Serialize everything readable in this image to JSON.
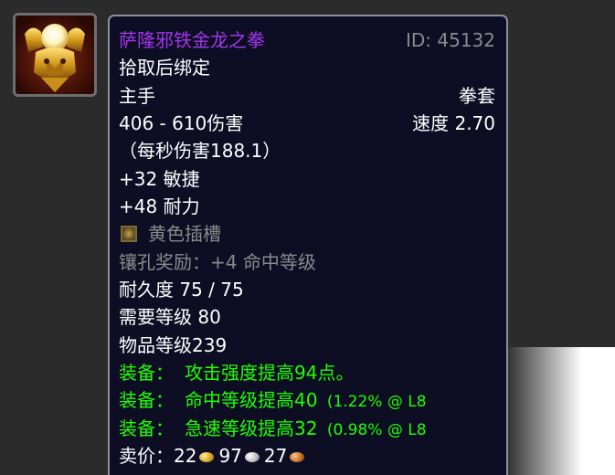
{
  "item": {
    "name": "萨隆邪铁金龙之拳",
    "id_text": "ID: 45132",
    "bind": "拾取后绑定",
    "slot": "主手",
    "type": "拳套",
    "damage": "406 - 610伤害",
    "speed": "速度 2.70",
    "dps": "（每秒伤害188.1）",
    "stat_agility": "+32 敏捷",
    "stat_stamina": "+48 耐力",
    "socket_label": "黄色插槽",
    "socket_bonus": "镶孔奖励：+4 命中等级",
    "durability": "耐久度 75 / 75",
    "required_level": "需要等级 80",
    "item_level": "物品等级239",
    "equip_effects": [
      {
        "prefix": "装备：",
        "text": "攻击强度提高94点。",
        "detail": ""
      },
      {
        "prefix": "装备：",
        "text": "命中等级提高40",
        "detail": "(1.22% @ L8"
      },
      {
        "prefix": "装备：",
        "text": "急速等级提高32",
        "detail": "(0.98% @ L8"
      }
    ],
    "sell_price": {
      "label": "卖价：",
      "gold": "22",
      "silver": "97",
      "copper": "27"
    }
  },
  "icons": {
    "item_icon": "golden-dragon-fist-icon",
    "socket_icon": "yellow-socket-icon",
    "coins": [
      "gold-coin-icon",
      "silver-coin-icon",
      "copper-coin-icon"
    ]
  },
  "colors": {
    "tooltip_bg": "#0d0e24",
    "epic_name": "#a335ee",
    "equip_green": "#1eff00",
    "muted_gray": "#8a8a8a",
    "border": "#8d8f9c"
  }
}
